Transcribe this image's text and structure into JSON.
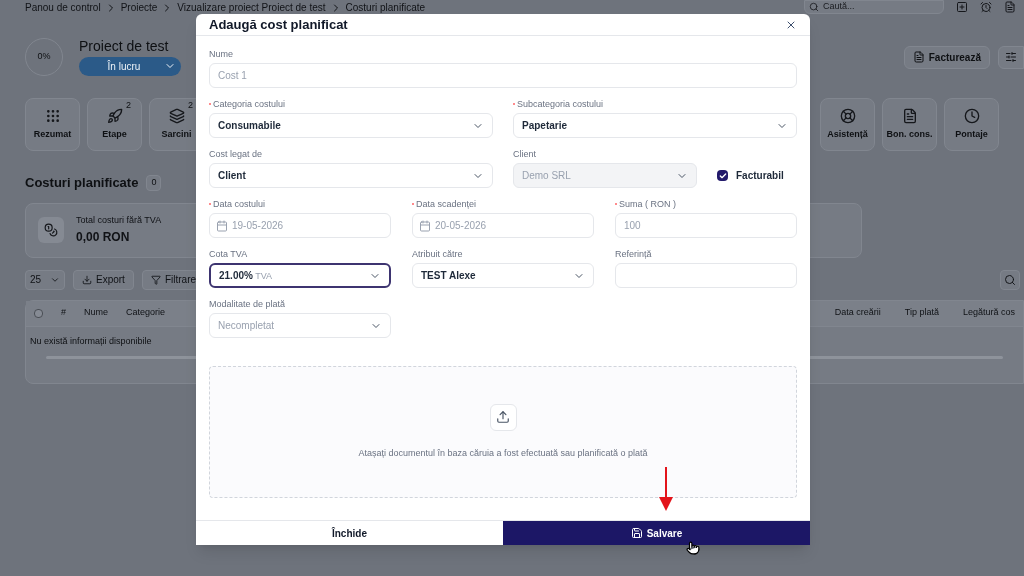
{
  "background": {
    "breadcrumb": [
      "Panou de control",
      "Proiecte",
      "Vizualizare proiect Proiect de test",
      "Costuri planificate"
    ],
    "search": {
      "placeholder": "Caută..."
    },
    "project": {
      "progress": "0%",
      "title": "Proiect de test",
      "status": "În lucru"
    },
    "actions": [
      {
        "kind": "invoice",
        "label": "Facturează"
      },
      {
        "kind": "settings"
      }
    ],
    "tiles_left": [
      {
        "kind": "grid",
        "label": "Rezumat"
      },
      {
        "kind": "rocket",
        "label": "Etape",
        "badge": "2"
      },
      {
        "kind": "layers",
        "label": "Sarcini",
        "badge": "2"
      }
    ],
    "tiles_right": [
      {
        "kind": "lifebuoy",
        "label": "Asistență"
      },
      {
        "kind": "document",
        "label": "Bon. cons."
      },
      {
        "kind": "clock",
        "label": "Pontaje"
      }
    ],
    "section": {
      "title": "Costuri planificate",
      "count": "0"
    },
    "summary": {
      "label": "Total costuri fără TVA",
      "amount": "0,00 RON"
    },
    "toolbar": {
      "page_size": "25",
      "export": "Export",
      "filter": "Filtrare"
    },
    "table": {
      "select_all_checked": false,
      "columns_left": [
        "#",
        "Nume",
        "Categorie"
      ],
      "columns_right": [
        "Data creării",
        "Tip plată",
        "Legătură cos"
      ],
      "empty": "Nu există informații disponibile"
    }
  },
  "modal": {
    "title": "Adaugă cost planificat",
    "rows": [
      {
        "kind": "full",
        "fields": [
          {
            "kind": "text",
            "label": "Nume",
            "required": false,
            "placeholder": "Cost 1"
          }
        ]
      },
      {
        "kind": "halves",
        "fields": [
          {
            "kind": "select",
            "label": "Categoria costului",
            "required": true,
            "value": "Consumabile",
            "disabled": false,
            "focused": false
          },
          {
            "kind": "select",
            "label": "Subcategoria costului",
            "required": true,
            "value": "Papetarie",
            "disabled": false,
            "focused": false
          }
        ]
      },
      {
        "kind": "halves",
        "fields": [
          {
            "kind": "select",
            "label": "Cost legat de",
            "required": false,
            "value": "Client",
            "disabled": false,
            "focused": false
          },
          {
            "kind": "select",
            "label": "Client",
            "required": false,
            "value": "Demo SRL",
            "disabled": true,
            "focused": false
          },
          {
            "kind": "checkbox",
            "label": "Facturabil",
            "checked": true
          }
        ]
      },
      {
        "kind": "thirds",
        "fields": [
          {
            "kind": "date",
            "label": "Data costului",
            "required": true,
            "placeholder": "19-05-2026"
          },
          {
            "kind": "date",
            "label": "Data scadenței",
            "required": true,
            "placeholder": "20-05-2026"
          },
          {
            "kind": "text",
            "label": "Suma ( RON )",
            "required": true,
            "placeholder": "100"
          }
        ]
      },
      {
        "kind": "thirds",
        "fields": [
          {
            "kind": "select",
            "label": "Cota TVA",
            "required": false,
            "value": "21.00%",
            "suffix": "TVA",
            "disabled": false,
            "focused": true
          },
          {
            "kind": "select",
            "label": "Atribuit către",
            "required": false,
            "value": "TEST Alexe",
            "disabled": false,
            "focused": false
          },
          {
            "kind": "text",
            "label": "Referință",
            "required": false
          }
        ]
      },
      {
        "kind": "thirds",
        "fields": [
          {
            "kind": "select",
            "label": "Modalitate de plată",
            "required": false,
            "placeholder": "Necompletat",
            "disabled": false,
            "focused": false
          }
        ]
      }
    ],
    "upload": {
      "text": "Atașați documentul în baza căruia a fost efectuată sau planificată o plată"
    },
    "buttons": [
      {
        "kind": "secondary",
        "label": "Închide"
      },
      {
        "kind": "primary",
        "label": "Salvare"
      }
    ]
  }
}
